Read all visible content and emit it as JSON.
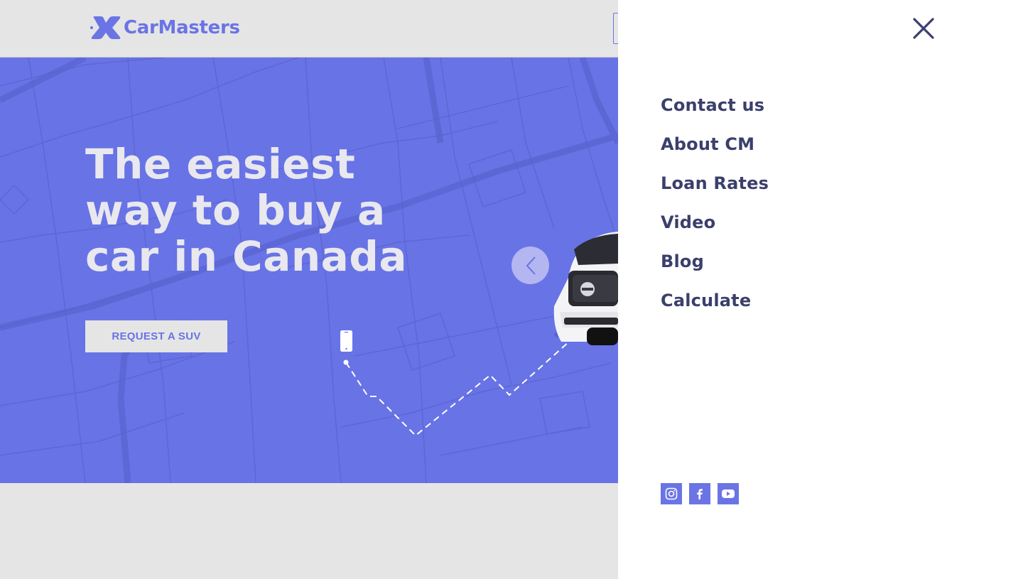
{
  "brand": {
    "name": "CarMasters",
    "logo_icon": "carmasters-x-logo-icon",
    "accent_color": "#6b74e5",
    "hero_color": "#6873e6"
  },
  "hero": {
    "title": "The easiest way to buy a car in Canada",
    "cta_label": "REQUEST A SUV",
    "prev_icon": "chevron-left-icon",
    "phone_icon": "smartphone-icon"
  },
  "drawer": {
    "close_icon": "close-icon",
    "nav": [
      {
        "label": "Contact us"
      },
      {
        "label": "About CM"
      },
      {
        "label": "Loan Rates"
      },
      {
        "label": "Video"
      },
      {
        "label": "Blog"
      },
      {
        "label": "Calculate"
      }
    ],
    "social": [
      {
        "icon": "instagram-icon"
      },
      {
        "icon": "facebook-icon"
      },
      {
        "icon": "youtube-icon"
      }
    ]
  }
}
